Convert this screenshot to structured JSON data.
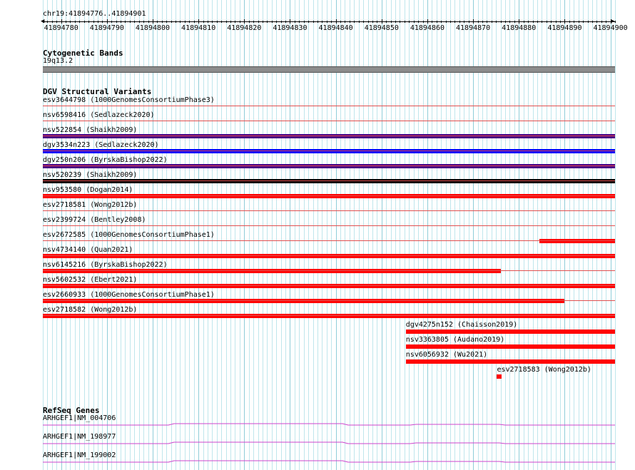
{
  "colors": {
    "grid_minor": "#bfe6ec",
    "grid_major": "#8fcdd8",
    "band": "#8c8c8c",
    "variant_line": "#e05050",
    "red": "#ff0000",
    "purple": "#4b0082",
    "blue": "#0000ff",
    "black": "#000000",
    "gene": "#cc44cc"
  },
  "ruler": {
    "location": "chr19:41894776..41894901",
    "start": 41894776,
    "end": 41894901,
    "ticks": [
      "41894780",
      "41894790",
      "41894800",
      "41894810",
      "41894820",
      "41894830",
      "41894840",
      "41894850",
      "41894860",
      "41894870",
      "41894880",
      "41894890",
      "41894900"
    ]
  },
  "cytobands": {
    "title": "Cytogenetic Bands",
    "band_label": "19q13.2"
  },
  "dgv": {
    "title": "DGV Structural Variants",
    "variants": [
      {
        "label": "esv3644798 (1000GenomesConsortiumPhase3)",
        "bar_color": null,
        "start": null,
        "end": null
      },
      {
        "label": "nsv6598416 (Sedlazeck2020)",
        "bar_color": "#4b0082",
        "start": 41894776,
        "end": 41894901
      },
      {
        "label": "nsv522854 (Shaikh2009)",
        "bar_color": "#0000ff",
        "start": 41894776,
        "end": 41894901
      },
      {
        "label": "dgv3534n223 (Sedlazeck2020)",
        "bar_color": "#4b0082",
        "start": 41894776,
        "end": 41894901
      },
      {
        "label": "dgv250n206 (ByrskaBishop2022)",
        "bar_color": "#000000",
        "start": 41894776,
        "end": 41894901
      },
      {
        "label": "nsv520239 (Shaikh2009)",
        "bar_color": "#ff0000",
        "start": 41894776,
        "end": 41894901
      },
      {
        "label": "nsv953580 (Dogan2014)",
        "bar_color": null,
        "start": null,
        "end": null
      },
      {
        "label": "esv2718581 (Wong2012b)",
        "bar_color": null,
        "start": null,
        "end": null
      },
      {
        "label": "esv2399724 (Bentley2008)",
        "bar_color": "#ff0000",
        "start": 41894884.5,
        "end": 41894901
      },
      {
        "label": "esv2672585 (1000GenomesConsortiumPhase1)",
        "bar_color": "#ff0000",
        "start": 41894776,
        "end": 41894901
      },
      {
        "label": "nsv4734140 (Quan2021)",
        "bar_color": "#ff0000",
        "start": 41894776,
        "end": 41894876
      },
      {
        "label": "nsv6145216 (ByrskaBishop2022)",
        "bar_color": "#ff0000",
        "start": 41894776,
        "end": 41894901
      },
      {
        "label": "nsv5602532 (Ebert2021)",
        "bar_color": "#ff0000",
        "start": 41894776,
        "end": 41894890
      },
      {
        "label": "esv2660933 (1000GenomesConsortiumPhase1)",
        "bar_color": "#ff0000",
        "start": 41894776,
        "end": 41894901
      },
      {
        "label": "esv2718582 (Wong2012b)",
        "bar_color": null,
        "start": null,
        "end": null
      }
    ],
    "partial_variants": [
      {
        "label": "dgv4275n152 (Chaisson2019)",
        "start": 41894855.3,
        "end": 41894901
      },
      {
        "label": "nsv3363805 (Audano2019)",
        "start": 41894855.3,
        "end": 41894901
      },
      {
        "label": "nsv6056932 (Wu2021)",
        "start": 41894855.3,
        "end": 41894901
      },
      {
        "label": "esv2718583 (Wong2012b)",
        "start": 41894875.2,
        "end": 41894876.2
      }
    ]
  },
  "refseq": {
    "title": "RefSeq Genes",
    "genes": [
      {
        "label": "ARHGEF1|NM_004706"
      },
      {
        "label": "ARHGEF1|NM_198977"
      },
      {
        "label": "ARHGEF1|NM_199002"
      }
    ]
  }
}
